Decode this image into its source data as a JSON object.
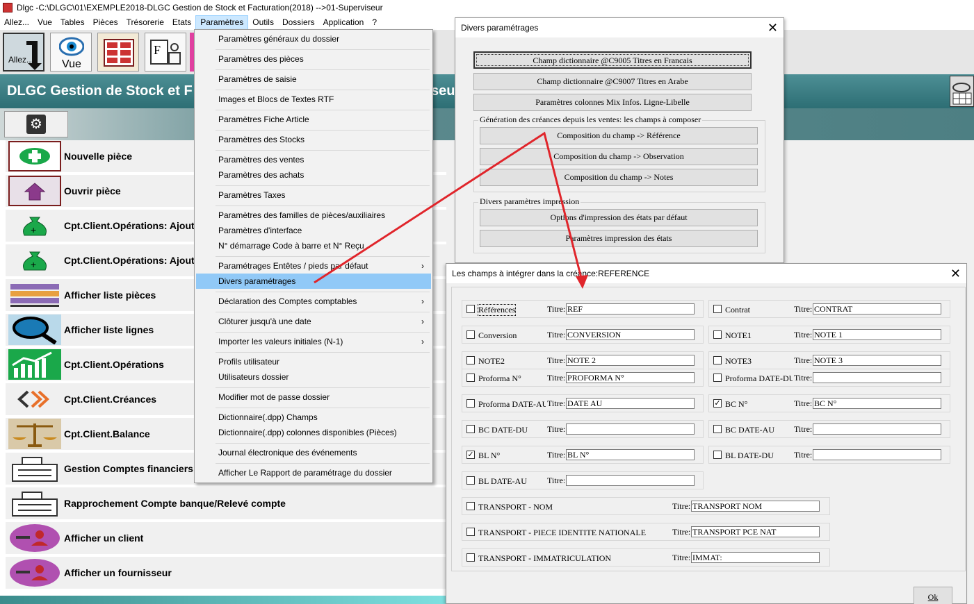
{
  "window": {
    "title": "Dlgc -C:\\DLGC\\01\\EXEMPLE2018-DLGC Gestion de Stock et Facturation(2018) -->01-Superviseur"
  },
  "menubar": [
    "Allez...",
    "Vue",
    "Tables",
    "Pièces",
    "Trésorerie",
    "Etats",
    "Paramètres",
    "Outils",
    "Dossiers",
    "Application",
    "?"
  ],
  "toolbar": {
    "allez_label": "Allez...",
    "vue_label": "Vue"
  },
  "banner": {
    "title": "DLGC Gestion de Stock et F",
    "title_right": "seu"
  },
  "left_list": [
    {
      "label": "Nouvelle pièce",
      "icon": "add-icon"
    },
    {
      "label": "Ouvrir pièce",
      "icon": "home-icon"
    },
    {
      "label": "Cpt.Client.Opérations: Ajouter",
      "icon": "money-bag-icon"
    },
    {
      "label": "Cpt.Client.Opérations: Ajouter",
      "icon": "money-bag-icon"
    },
    {
      "label": "Afficher liste pièces",
      "icon": "list-icon"
    },
    {
      "label": "Afficher liste lignes",
      "icon": "magnifier-icon"
    },
    {
      "label": "Cpt.Client.Opérations",
      "icon": "chart-icon"
    },
    {
      "label": "Cpt.Client.Créances",
      "icon": "arrows-icon"
    },
    {
      "label": "Cpt.Client.Balance",
      "icon": "scale-icon"
    },
    {
      "label": "Gestion Comptes financiers",
      "icon": "register-icon"
    },
    {
      "label": "Rapprochement Compte banque/Relevé compte",
      "icon": "register-icon"
    },
    {
      "label": "Afficher un client",
      "icon": "user-icon"
    },
    {
      "label": "Afficher un fournisseur",
      "icon": "user-icon"
    }
  ],
  "dropdown": [
    {
      "label": "Paramètres généraux du dossier",
      "arrow": ""
    },
    {
      "label": "Paramètres des pièces",
      "arrow": ""
    },
    {
      "label": "Paramètres de saisie",
      "arrow": ""
    },
    {
      "label": "Images et Blocs de Textes RTF",
      "arrow": ""
    },
    {
      "label": "Paramètres Fiche Article",
      "arrow": ""
    },
    {
      "label": "Paramètres des Stocks",
      "arrow": ""
    },
    {
      "label": "Paramètres des ventes",
      "arrow": ""
    },
    {
      "label": "Paramètres des achats",
      "arrow": ""
    },
    {
      "label": "Paramètres Taxes",
      "arrow": ""
    },
    {
      "label": "Paramètres des familles de pièces/auxiliaires",
      "arrow": ""
    },
    {
      "label": "Paramètres d'interface",
      "arrow": ""
    },
    {
      "label": "N° démarrage Code à barre et N° Reçu",
      "arrow": ""
    },
    {
      "label": "Paramétrages Entêtes / pieds par défaut",
      "arrow": "›"
    },
    {
      "label": "Divers paramétrages",
      "arrow": ""
    },
    {
      "label": "Déclaration des Comptes comptables",
      "arrow": "›"
    },
    {
      "label": "Clôturer jusqu'à une date",
      "arrow": "›"
    },
    {
      "label": "Importer les valeurs initiales (N-1)",
      "arrow": "›"
    },
    {
      "label": "Profils utilisateur",
      "arrow": ""
    },
    {
      "label": "Utilisateurs dossier",
      "arrow": ""
    },
    {
      "label": "Modifier mot de passe dossier",
      "arrow": ""
    },
    {
      "label": "Dictionnaire(.dpp) Champs",
      "arrow": ""
    },
    {
      "label": "Dictionnaire(.dpp) colonnes disponibles (Pièces)",
      "arrow": ""
    },
    {
      "label": "Journal électronique des événements",
      "arrow": ""
    },
    {
      "label": "Afficher Le Rapport de paramétrage du dossier",
      "arrow": ""
    }
  ],
  "dialog1": {
    "title": "Divers paramétrages",
    "btn_fr": "Champ dictionnaire  @C9005 Titres en Francais",
    "btn_ar": "Champ dictionnaire  @C9007 Titres en Arabe",
    "btn_mix": "Paramètres colonnes Mix Infos. Ligne-Libelle",
    "group1": "Génération des créances depuis les ventes: les champs à composer",
    "btn_ref": "Composition du champ -> Référence",
    "btn_obs": "Composition du champ -> Observation",
    "btn_notes": "Composition du champ -> Notes",
    "group2": "Divers paramètres impression",
    "btn_opt": "Options d'impression des états par défaut",
    "btn_imp": "Paramètres impression des états"
  },
  "dialog2": {
    "title": "Les champs à intégrer dans la créance:REFERENCE",
    "titre_label": "Titre:",
    "ok": "Ok",
    "fields": [
      {
        "name": "Références",
        "checked": false,
        "value": "REF"
      },
      {
        "name": "Contrat",
        "checked": false,
        "value": "CONTRAT"
      },
      {
        "name": "Conversion",
        "checked": false,
        "value": "CONVERSION"
      },
      {
        "name": "NOTE1",
        "checked": false,
        "value": "NOTE 1"
      },
      {
        "name": "NOTE2",
        "checked": false,
        "value": "NOTE 2"
      },
      {
        "name": "NOTE3",
        "checked": false,
        "value": "NOTE 3"
      },
      {
        "name": "Proforma N°",
        "checked": false,
        "value": "PROFORMA N°"
      },
      {
        "name": "Proforma DATE-DU",
        "checked": false,
        "value": ""
      },
      {
        "name": "Proforma DATE-AU",
        "checked": false,
        "value": "DATE AU"
      },
      {
        "name": "BC N°",
        "checked": true,
        "value": "BC N°"
      },
      {
        "name": "BC DATE-DU",
        "checked": false,
        "value": ""
      },
      {
        "name": "BC DATE-AU",
        "checked": false,
        "value": ""
      },
      {
        "name": "BL N°",
        "checked": true,
        "value": "BL N°"
      },
      {
        "name": "BL DATE-DU",
        "checked": false,
        "value": ""
      },
      {
        "name": "BL DATE-AU",
        "checked": false,
        "value": ""
      },
      {
        "name": "TRANSPORT - NOM",
        "checked": false,
        "value": "TRANSPORT NOM"
      },
      {
        "name": "TRANSPORT - PIECE IDENTITE NATIONALE",
        "checked": false,
        "value": "TRANSPORT PCE NAT"
      },
      {
        "name": "TRANSPORT - IMMATRICULATION",
        "checked": false,
        "value": "IMMAT:"
      }
    ]
  },
  "colors": {
    "annotation_arrow": "#e0252b",
    "menu_selected": "#91c9f7",
    "banner": "#3d7f85"
  }
}
